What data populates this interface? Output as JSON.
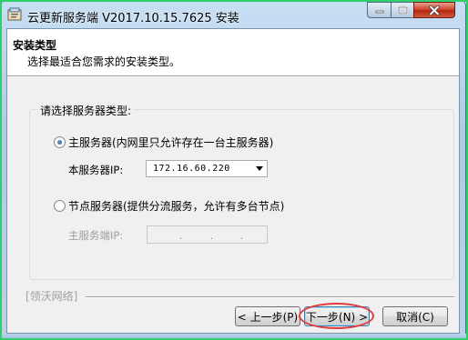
{
  "window": {
    "title": "云更新服务端 V2017.10.15.7625 安装",
    "controls": [
      "minimize-icon",
      "maximize-icon",
      "close-icon"
    ]
  },
  "header": {
    "title": "安装类型",
    "subtitle": "选择最适合您需求的安装类型。"
  },
  "group": {
    "legend": "请选择服务器类型:"
  },
  "options": {
    "main": {
      "label": "主服务器(内网里只允许存在一台主服务器)",
      "selected": true,
      "ip_label": "本服务器IP:",
      "ip_value": "172.16.60.220"
    },
    "node": {
      "label": "节点服务器(提供分流服务，允许有多台节点)",
      "selected": false,
      "ip_label": "主服务端IP:",
      "ip_value": "",
      "ip_separators": [
        ".",
        ".",
        "."
      ]
    }
  },
  "footer": {
    "brand": "[领沃网络]"
  },
  "buttons": {
    "back": "< 上一步(P)",
    "next": "下一步(N) >",
    "cancel": "取消(C)"
  },
  "colors": {
    "highlight": "#e23b3b",
    "outer_border": "#2fd06a",
    "close_button": "#c8432a"
  }
}
